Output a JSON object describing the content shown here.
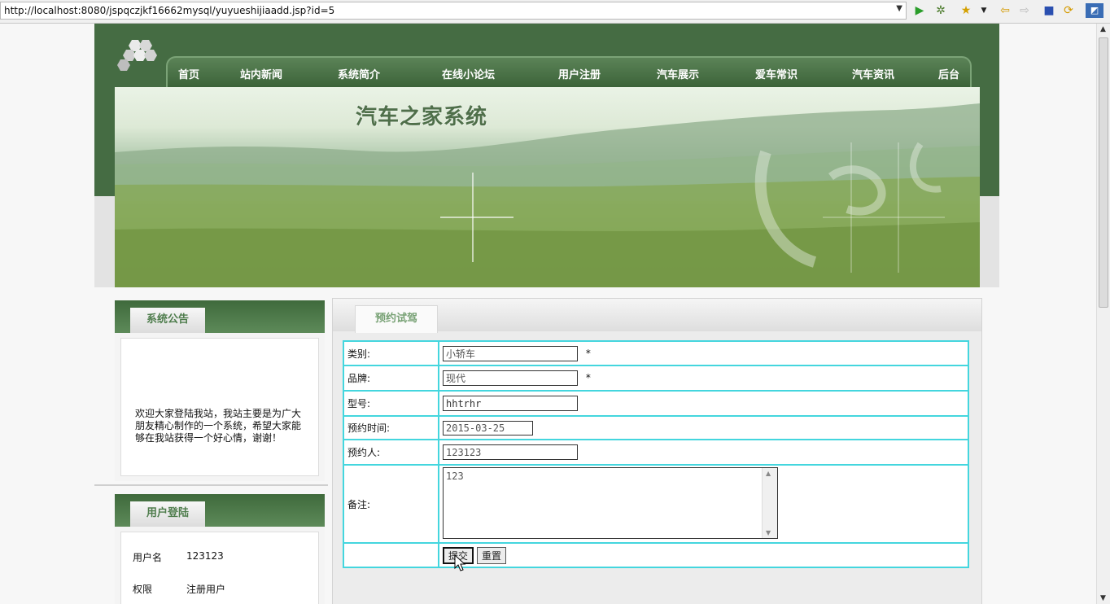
{
  "browser": {
    "url": "http://localhost:8080/jspqczjkf16662mysql/yuyueshijiaadd.jsp?id=5",
    "icons": [
      "go-icon",
      "debug-icon",
      "favorites-icon",
      "back-icon",
      "forward-icon",
      "stop-icon",
      "refresh-icon",
      "app-icon"
    ]
  },
  "nav": {
    "items": [
      {
        "label": "首页"
      },
      {
        "label": "站内新闻"
      },
      {
        "label": "系统简介"
      },
      {
        "label": "在线小论坛"
      },
      {
        "label": "用户注册"
      },
      {
        "label": "汽车展示"
      },
      {
        "label": "爱车常识"
      },
      {
        "label": "汽车资讯"
      },
      {
        "label": "后台"
      }
    ]
  },
  "banner": {
    "title": "汽车之家系统"
  },
  "notice": {
    "title": "系统公告",
    "text": "欢迎大家登陆我站，我站主要是为广大朋友精心制作的一个系统，希望大家能够在我站获得一个好心情，谢谢！"
  },
  "login": {
    "title": "用户登陆",
    "username_label": "用户名",
    "username_value": "123123",
    "role_label": "权限",
    "role_value": "注册用户"
  },
  "main": {
    "tab_title": "预约试驾",
    "form": {
      "category": {
        "label": "类别:",
        "value": "小轿车",
        "required": "*"
      },
      "brand": {
        "label": "品牌:",
        "value": "现代",
        "required": "*"
      },
      "model": {
        "label": "型号:",
        "value": "hhtrhr"
      },
      "date": {
        "label": "预约时间:",
        "value": "2015-03-25"
      },
      "person": {
        "label": "预约人:",
        "value": "123123"
      },
      "remark": {
        "label": "备注:",
        "value": "123"
      },
      "submit_label": "提交",
      "reset_label": "重置"
    }
  }
}
